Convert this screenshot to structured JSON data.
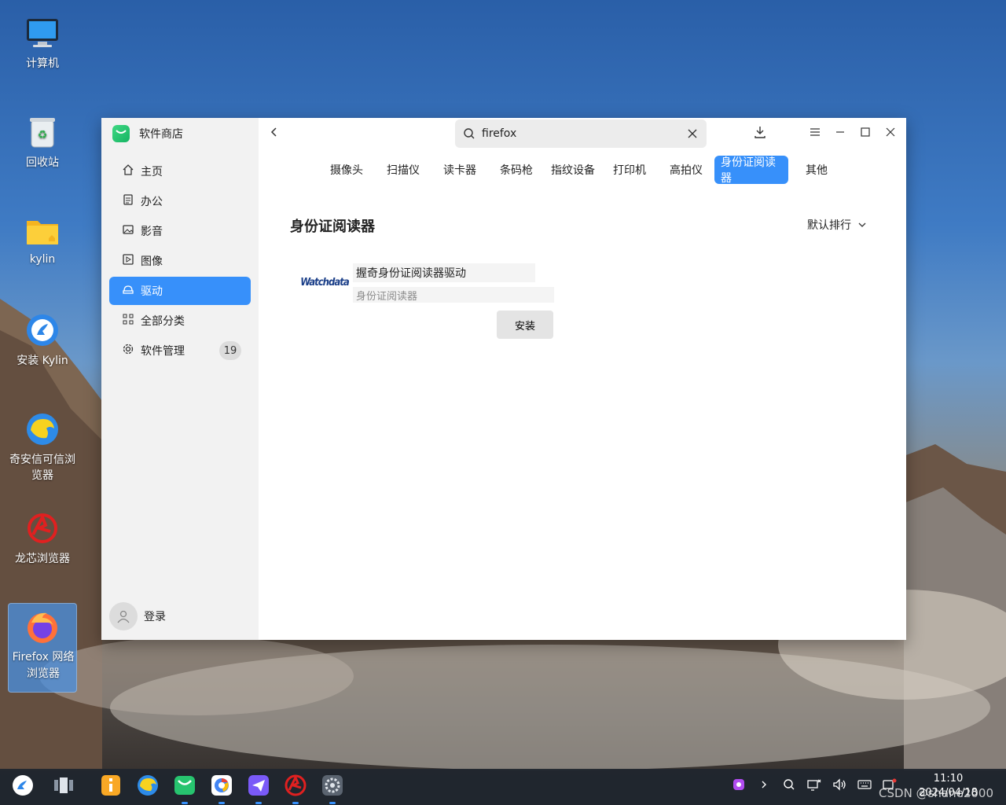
{
  "desktop": {
    "icons": [
      {
        "label": "计算机",
        "icon": "computer-icon"
      },
      {
        "label": "回收站",
        "icon": "trash-icon"
      },
      {
        "label": "kylin",
        "icon": "folder-icon"
      },
      {
        "label": "安装 Kylin",
        "icon": "install-kylin-icon"
      },
      {
        "label": "奇安信可信浏览器",
        "icon": "qianxin-browser-icon"
      },
      {
        "label": "龙芯浏览器",
        "icon": "loongson-browser-icon"
      },
      {
        "label": "Firefox 网络浏览器",
        "icon": "firefox-icon"
      }
    ]
  },
  "window": {
    "app_title": "软件商店",
    "sidebar": {
      "items": [
        {
          "label": "主页",
          "icon": "home-icon"
        },
        {
          "label": "办公",
          "icon": "document-icon"
        },
        {
          "label": "影音",
          "icon": "image-icon"
        },
        {
          "label": "图像",
          "icon": "play-icon"
        },
        {
          "label": "驱动",
          "icon": "driver-icon",
          "active": true
        },
        {
          "label": "全部分类",
          "icon": "grid-icon"
        },
        {
          "label": "软件管理",
          "icon": "gear-icon",
          "badge": "19"
        }
      ],
      "login_label": "登录"
    },
    "search": {
      "value": "firefox",
      "placeholder": ""
    },
    "categories": [
      {
        "label": "摄像头"
      },
      {
        "label": "扫描仪"
      },
      {
        "label": "读卡器"
      },
      {
        "label": "条码枪"
      },
      {
        "label": "指纹设备"
      },
      {
        "label": "打印机"
      },
      {
        "label": "高拍仪"
      },
      {
        "label": "身份证阅读器",
        "active": true
      },
      {
        "label": "其他"
      }
    ],
    "section_title": "身份证阅读器",
    "sort_label": "默认排行",
    "apps": [
      {
        "name": "握奇身份证阅读器驱动",
        "description": "身份证阅读器",
        "logo_text": "Watchdata",
        "install_label": "安装"
      }
    ]
  },
  "taskbar": {
    "clock_time": "11:10",
    "clock_date": "2024/04/18"
  },
  "watermark": "CSDN @shane2000",
  "colors": {
    "accent": "#3790fa",
    "sidebar_bg": "#f2f2f2"
  }
}
